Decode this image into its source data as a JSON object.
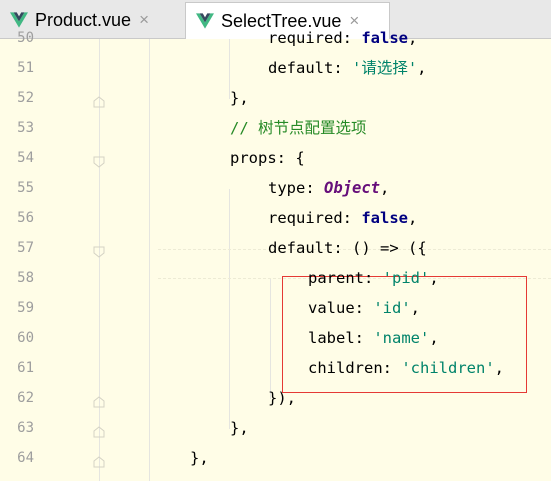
{
  "tabs": [
    {
      "label": "Product.vue",
      "active": false
    },
    {
      "label": "SelectTree.vue",
      "active": true
    }
  ],
  "tab_close_glyph": "×",
  "icons": {
    "vue": "vue-logo-icon",
    "close": "close-icon",
    "fold": "fold-marker-icon"
  },
  "colors": {
    "editor_bg": "#FFFDE7",
    "line_number": "#9E9E9E",
    "string": "#00836A",
    "comment": "#268A26",
    "boolean_keyword": "#000080",
    "type_keyword": "#660E7A",
    "highlight_box": "#E53935",
    "vue_logo": "#41B883"
  },
  "lines": [
    {
      "num": "50",
      "parts": [
        {
          "t": "required",
          "c": "kw-prop"
        },
        {
          "t": ": ",
          "c": "punc"
        },
        {
          "t": "false",
          "c": "kw-bool"
        },
        {
          "t": ",",
          "c": "punc"
        }
      ]
    },
    {
      "num": "51",
      "parts": [
        {
          "t": "default",
          "c": "kw-prop"
        },
        {
          "t": ": ",
          "c": "punc"
        },
        {
          "t": "'请选择'",
          "c": "str"
        },
        {
          "t": ",",
          "c": "punc"
        }
      ]
    },
    {
      "num": "52",
      "parts": [
        {
          "t": "},",
          "c": "punc"
        }
      ]
    },
    {
      "num": "53",
      "parts": [
        {
          "t": "// 树节点配置选项",
          "c": "cmt"
        }
      ]
    },
    {
      "num": "54",
      "parts": [
        {
          "t": "props",
          "c": "kw-prop"
        },
        {
          "t": ": {",
          "c": "punc"
        }
      ]
    },
    {
      "num": "55",
      "parts": [
        {
          "t": "type",
          "c": "kw-prop"
        },
        {
          "t": ": ",
          "c": "punc"
        },
        {
          "t": "Object",
          "c": "kw-obj"
        },
        {
          "t": ",",
          "c": "punc"
        }
      ]
    },
    {
      "num": "56",
      "parts": [
        {
          "t": "required",
          "c": "kw-prop"
        },
        {
          "t": ": ",
          "c": "punc"
        },
        {
          "t": "false",
          "c": "kw-bool"
        },
        {
          "t": ",",
          "c": "punc"
        }
      ]
    },
    {
      "num": "57",
      "parts": [
        {
          "t": "default",
          "c": "kw-prop"
        },
        {
          "t": ": () => ({",
          "c": "punc"
        }
      ]
    },
    {
      "num": "58",
      "parts": [
        {
          "t": "parent",
          "c": "kw-prop"
        },
        {
          "t": ": ",
          "c": "punc"
        },
        {
          "t": "'pid'",
          "c": "str"
        },
        {
          "t": ",",
          "c": "punc"
        }
      ]
    },
    {
      "num": "59",
      "parts": [
        {
          "t": "value",
          "c": "kw-prop"
        },
        {
          "t": ": ",
          "c": "punc"
        },
        {
          "t": "'id'",
          "c": "str"
        },
        {
          "t": ",",
          "c": "punc"
        }
      ]
    },
    {
      "num": "60",
      "parts": [
        {
          "t": "label",
          "c": "kw-prop"
        },
        {
          "t": ": ",
          "c": "punc"
        },
        {
          "t": "'name'",
          "c": "str"
        },
        {
          "t": ",",
          "c": "punc"
        }
      ]
    },
    {
      "num": "61",
      "parts": [
        {
          "t": "children",
          "c": "kw-prop"
        },
        {
          "t": ": ",
          "c": "punc"
        },
        {
          "t": "'children'",
          "c": "str"
        },
        {
          "t": ",",
          "c": "punc"
        }
      ]
    },
    {
      "num": "62",
      "parts": [
        {
          "t": "}),",
          "c": "punc"
        }
      ]
    },
    {
      "num": "63",
      "parts": [
        {
          "t": "},",
          "c": "punc"
        }
      ]
    },
    {
      "num": "64",
      "parts": [
        {
          "t": "},",
          "c": "punc"
        }
      ]
    }
  ]
}
